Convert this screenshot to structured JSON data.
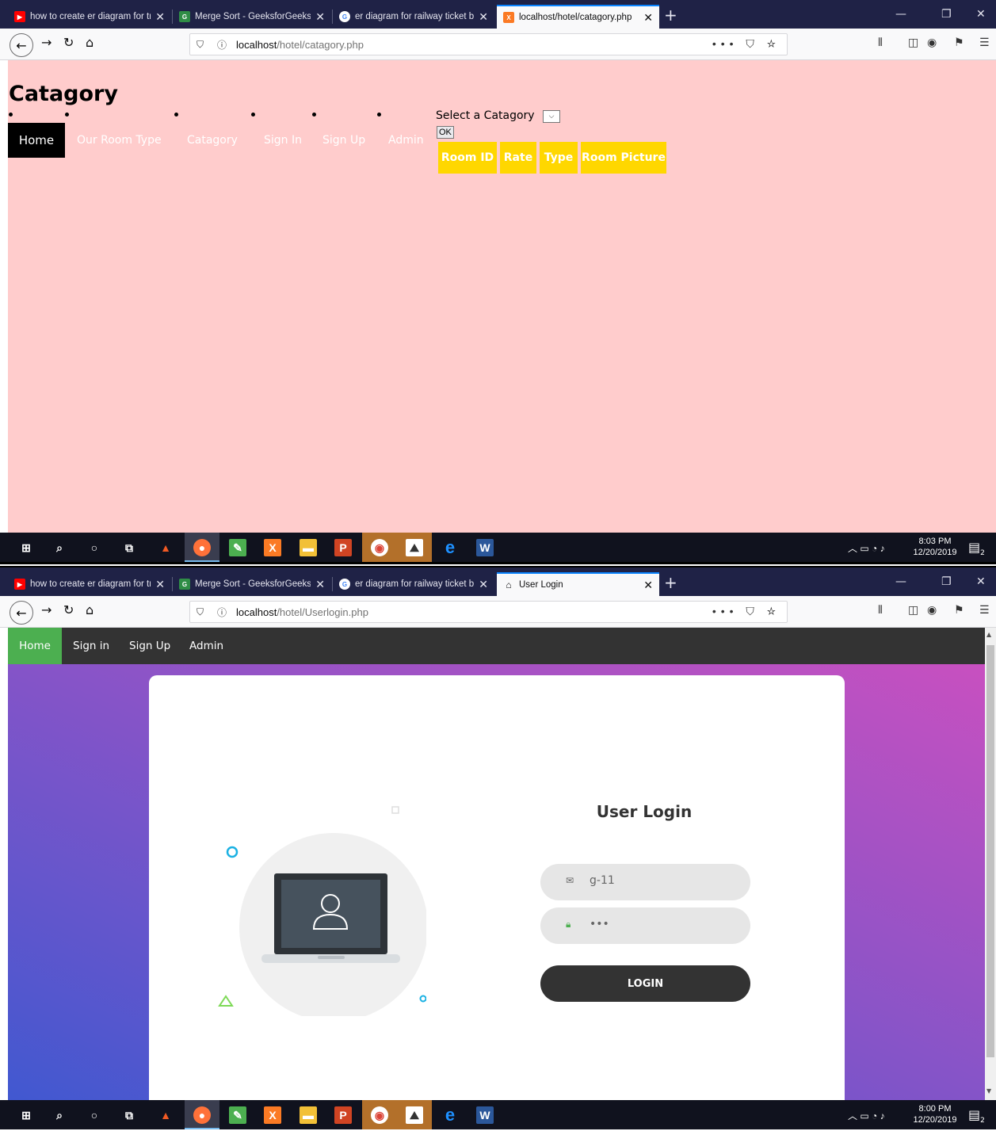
{
  "browser": {
    "tabs_shared": [
      {
        "title": "how to create er diagram for tr",
        "color": "#ff0000"
      },
      {
        "title": "Merge Sort - GeeksforGeeks",
        "color": "#2f8d46"
      },
      {
        "title": "er diagram for railway ticket bo",
        "color": "#4285f4"
      }
    ],
    "window_controls": [
      "—",
      "❐",
      "✕"
    ],
    "tab_close": "✕",
    "newtab": "+",
    "page_actions": "••• ⛉ ☆"
  },
  "shot1": {
    "active_tab": "localhost/hotel/catagory.php",
    "url_host": "localhost",
    "url_path": "/hotel/catagory.php",
    "page_title": "Catagory",
    "nav": [
      "Home",
      "Our Room Type",
      "Catagory",
      "Sign In",
      "Sign Up",
      "Admin"
    ],
    "select_label": "Select a Catagory",
    "ok_label": "OK",
    "table_headers": [
      "Room ID",
      "Rate",
      "Type",
      "Room Picture"
    ],
    "clock_time": "8:03 PM",
    "clock_date": "12/20/2019"
  },
  "shot2": {
    "active_tab": "User Login",
    "url_host": "localhost",
    "url_path": "/hotel/Userlogin.php",
    "nav": [
      "Home",
      "Sign in",
      "Sign Up",
      "Admin"
    ],
    "login_title": "User Login",
    "email_value": "g-11",
    "password_value": "•••",
    "login_button": "LOGIN",
    "clock_time": "8:00 PM",
    "clock_date": "12/20/2019"
  },
  "taskbar": {
    "notification_count": "2"
  },
  "colors": {
    "tabstrip": "#1f2246",
    "page1_bg": "#ffcccc",
    "table_header": "#ffd700",
    "login_nav": "#333333",
    "home_active": "#4caf50",
    "gradient_from": "#c850c0",
    "gradient_to": "#4158d0"
  }
}
